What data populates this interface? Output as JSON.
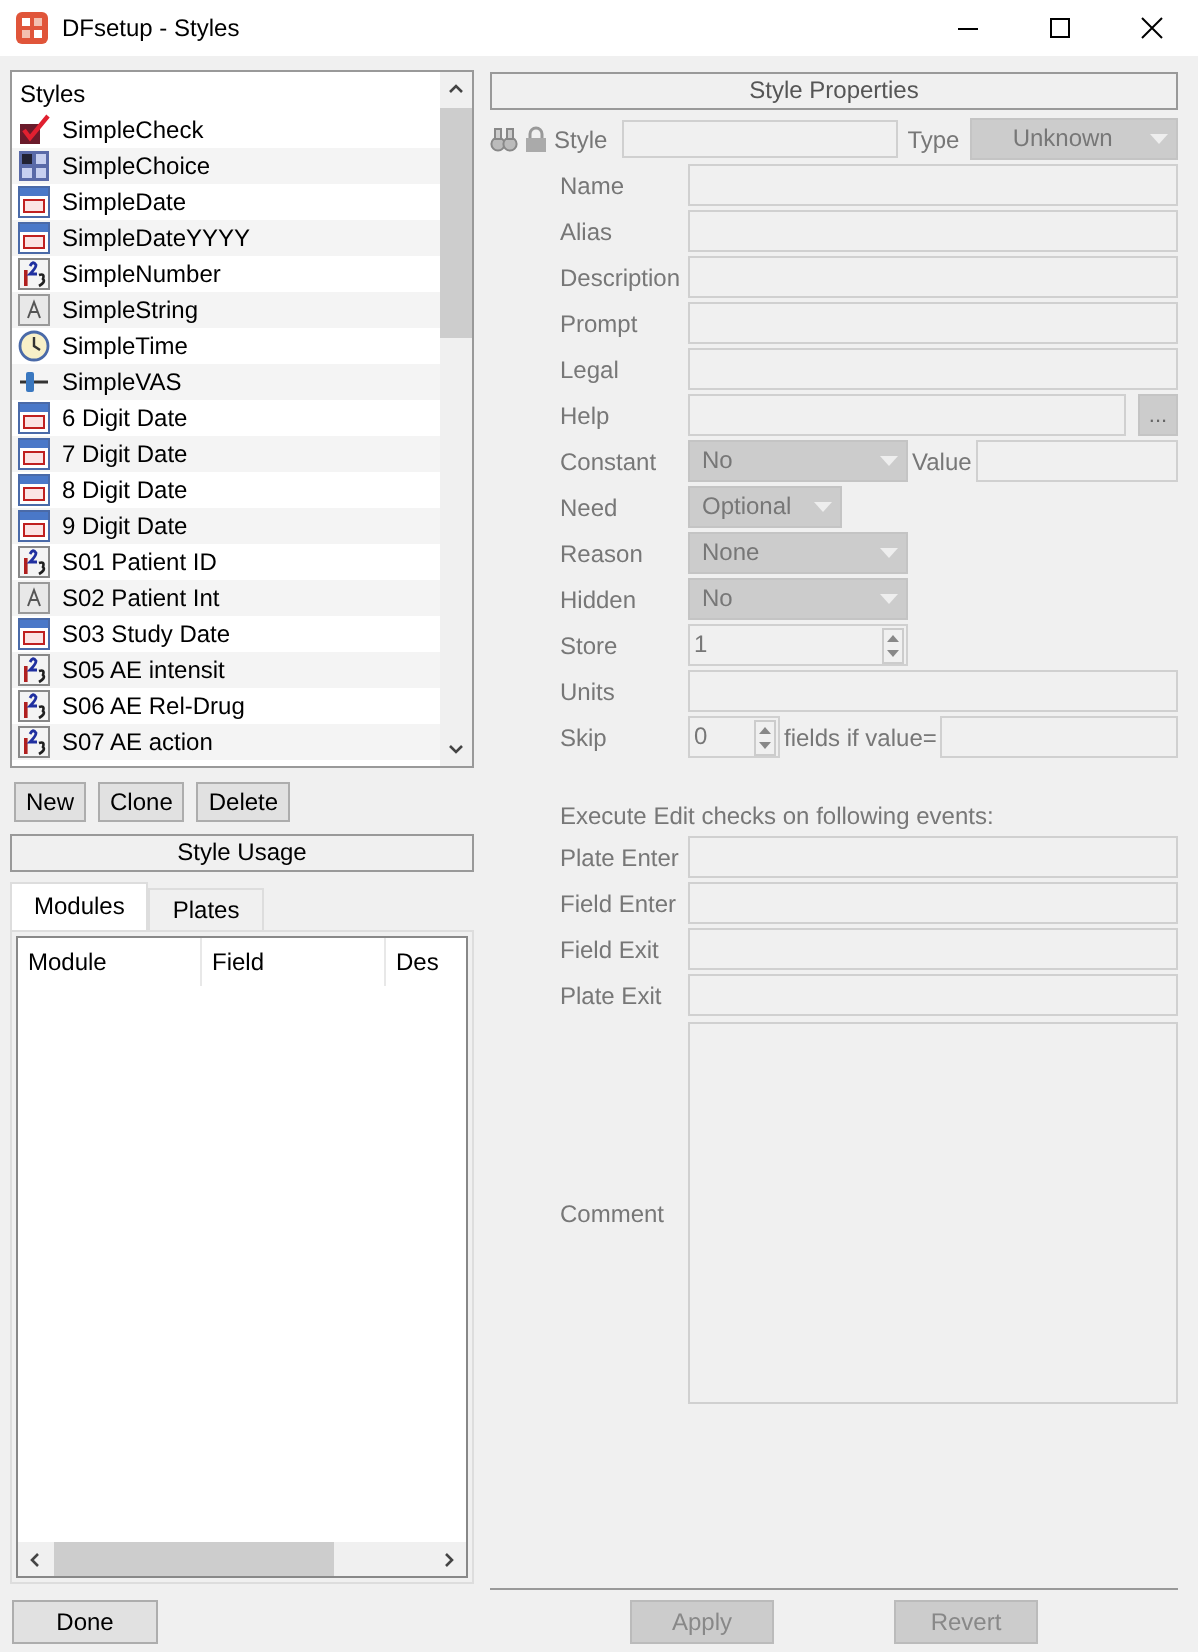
{
  "window": {
    "title": "DFsetup - Styles"
  },
  "styles_list": {
    "header": "Styles",
    "items": [
      {
        "label": "SimpleCheck",
        "kind": "check"
      },
      {
        "label": "SimpleChoice",
        "kind": "choice"
      },
      {
        "label": "SimpleDate",
        "kind": "date"
      },
      {
        "label": "SimpleDateYYYY",
        "kind": "date"
      },
      {
        "label": "SimpleNumber",
        "kind": "number"
      },
      {
        "label": "SimpleString",
        "kind": "string"
      },
      {
        "label": "SimpleTime",
        "kind": "time"
      },
      {
        "label": "SimpleVAS",
        "kind": "vas"
      },
      {
        "label": "6 Digit Date",
        "kind": "date"
      },
      {
        "label": "7 Digit Date",
        "kind": "date"
      },
      {
        "label": "8 Digit Date",
        "kind": "date"
      },
      {
        "label": "9 Digit Date",
        "kind": "date"
      },
      {
        "label": "S01 Patient ID",
        "kind": "number"
      },
      {
        "label": "S02 Patient Int",
        "kind": "string"
      },
      {
        "label": "S03 Study Date",
        "kind": "date"
      },
      {
        "label": "S05 AE intensit",
        "kind": "number"
      },
      {
        "label": "S06 AE Rel-Drug",
        "kind": "number"
      },
      {
        "label": "S07 AE action",
        "kind": "number"
      }
    ]
  },
  "list_buttons": [
    "New",
    "Clone",
    "Delete"
  ],
  "usage": {
    "title": "Style Usage",
    "tabs": [
      {
        "label": "Modules",
        "selected": true
      },
      {
        "label": "Plates",
        "selected": false
      }
    ],
    "columns": [
      "Module",
      "Field",
      "Des"
    ]
  },
  "done_button": "Done",
  "properties": {
    "title": "Style Properties",
    "style_label": "Style",
    "type_label": "Type",
    "type_value": "Unknown",
    "rows": [
      {
        "label": "Name",
        "kind": "text"
      },
      {
        "label": "Alias",
        "kind": "text"
      },
      {
        "label": "Description",
        "kind": "text"
      },
      {
        "label": "Prompt",
        "kind": "text"
      },
      {
        "label": "Legal",
        "kind": "text"
      },
      {
        "label": "Help",
        "kind": "browse",
        "button": "..."
      },
      {
        "label": "Constant",
        "kind": "constant",
        "value": "No",
        "value_label": "Value"
      },
      {
        "label": "Need",
        "kind": "shortselect",
        "value": "Optional"
      },
      {
        "label": "Reason",
        "kind": "select",
        "value": "None"
      },
      {
        "label": "Hidden",
        "kind": "select",
        "value": "No"
      },
      {
        "label": "Store",
        "kind": "spin",
        "value": "1"
      },
      {
        "label": "Units",
        "kind": "text"
      },
      {
        "label": "Skip",
        "kind": "skip",
        "value": "0",
        "suffix": "fields if value="
      }
    ],
    "events_title": "Execute Edit checks on following events:",
    "events": [
      "Plate Enter",
      "Field Enter",
      "Field Exit",
      "Plate Exit"
    ],
    "comment_label": "Comment"
  },
  "action_buttons": [
    {
      "label": "Apply",
      "disabled": true
    },
    {
      "label": "Revert",
      "disabled": true
    }
  ]
}
